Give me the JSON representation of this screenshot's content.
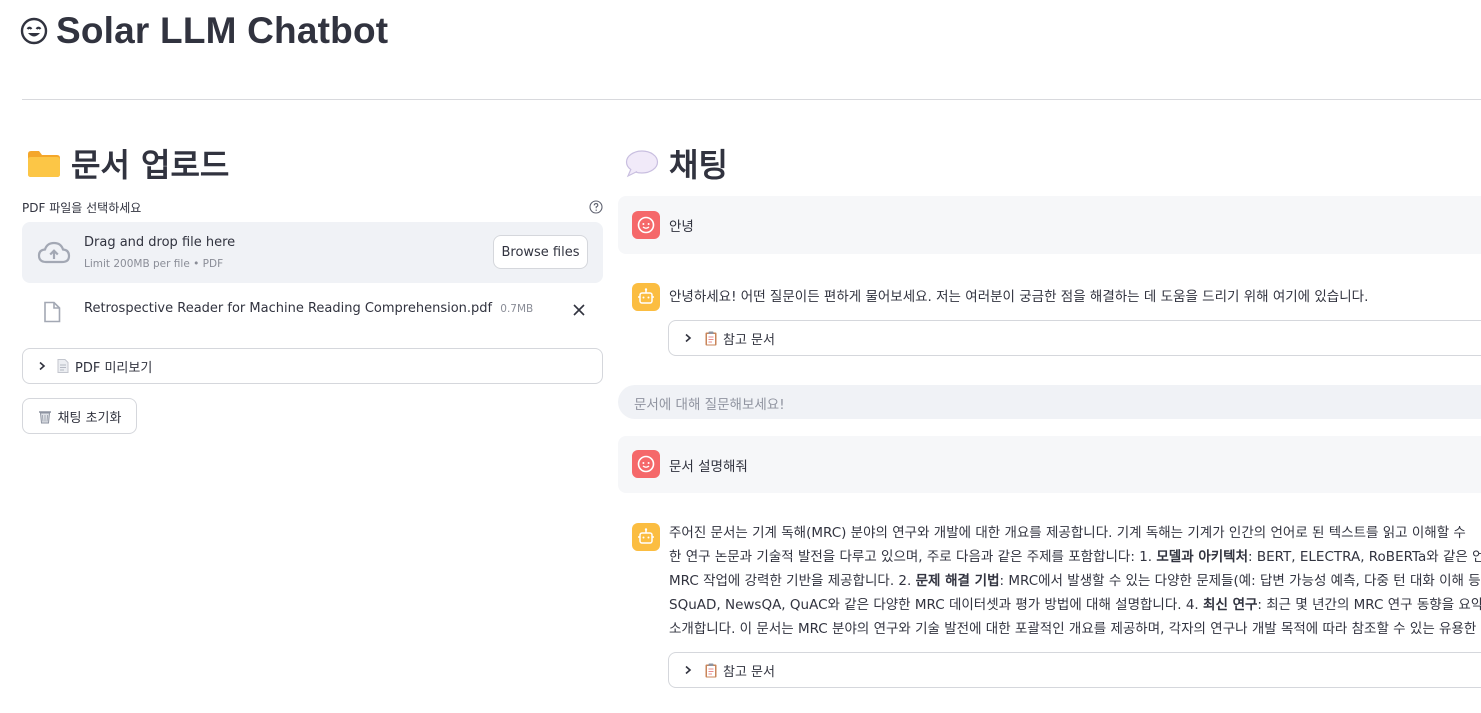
{
  "app": {
    "title": "Solar LLM Chatbot",
    "title_icon": "smiling-face-icon"
  },
  "upload_section": {
    "heading": "문서 업로드",
    "heading_icon": "folder-icon",
    "file_label": "PDF 파일을 선택하세요",
    "dropzone": {
      "main_text": "Drag and drop file here",
      "sub_text": "Limit 200MB per file • PDF",
      "browse_label": "Browse files"
    },
    "uploaded_file": {
      "name": "Retrospective Reader for Machine Reading Comprehension.pdf",
      "size": "0.7MB"
    },
    "preview_expander": {
      "label": "PDF 미리보기"
    },
    "reset_button": {
      "label": "채팅 초기화"
    }
  },
  "chat_section": {
    "heading": "채팅",
    "heading_icon": "speech-bubble-icon",
    "messages": [
      {
        "role": "user",
        "text": "안녕"
      },
      {
        "role": "assistant",
        "text": "안녕하세요! 어떤 질문이든 편하게 물어보세요. 저는 여러분이 궁금한 점을 해결하는 데 도움을 드리기 위해 여기에 있습니다.",
        "reference_label": "참고 문서"
      },
      {
        "role": "user",
        "text": "문서 설명해줘"
      },
      {
        "role": "assistant",
        "lines": [
          [
            "주어진 문서는 기계 독해(MRC) 분야의 연구와 개발에 대한 개요를 제공합니다. 기계 독해는 기계가 인간의 언어로 된 텍스트를 읽고 이해할 수"
          ],
          [
            "한 연구 논문과 기술적 발전을 다루고 있으며, 주로 다음과 같은 주제를 포함합니다: 1. ",
            "모델과 아키텍처",
            ": BERT, ELECTRA, RoBERTa와 같은 언어"
          ],
          [
            "MRC 작업에 강력한 기반을 제공합니다. 2. ",
            "문제 해결 기법",
            ": MRC에서 발생할 수 있는 다양한 문제들(예: 답변 가능성 예측, 다중 턴 대화 이해 등)"
          ],
          [
            "SQuAD, NewsQA, QuAC와 같은 다양한 MRC 데이터셋과 평가 방법에 대해 설명합니다. 4. ",
            "최신 연구",
            ": 최근 몇 년간의 MRC 연구 동향을 요약하며"
          ],
          [
            "소개합니다. 이 문서는 MRC 분야의 연구와 기술 발전에 대한 포괄적인 개요를 제공하며, 각자의 연구나 개발 목적에 따라 참조할 수 있는 유용한"
          ]
        ],
        "reference_label": "참고 문서"
      }
    ],
    "input_placeholder": "문서에 대해 질문해보세요!"
  },
  "colors": {
    "user_avatar": "#f5686a",
    "assistant_avatar": "#fbbd41",
    "text": "#31333f"
  }
}
